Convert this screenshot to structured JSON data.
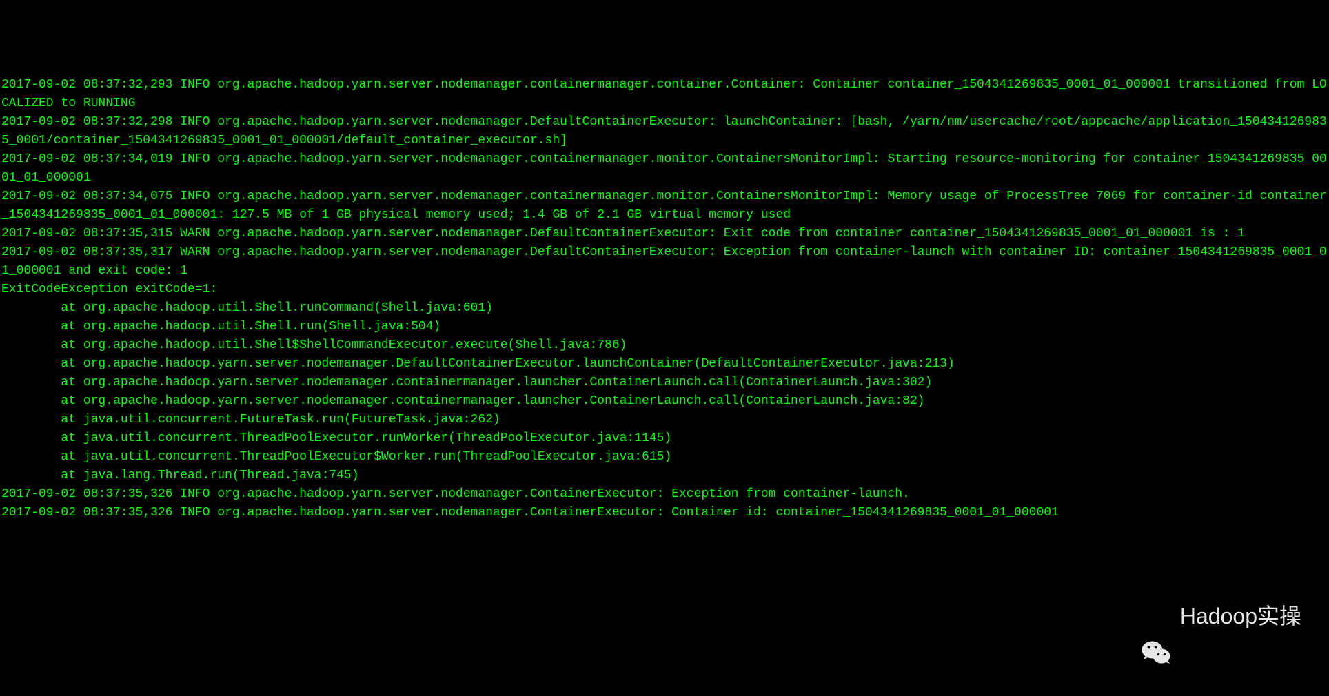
{
  "log": {
    "lines": [
      "2017-09-02 08:37:32,293 INFO org.apache.hadoop.yarn.server.nodemanager.containermanager.container.Container: Container container_1504341269835_0001_01_000001 transitioned from LOCALIZED to RUNNING",
      "2017-09-02 08:37:32,298 INFO org.apache.hadoop.yarn.server.nodemanager.DefaultContainerExecutor: launchContainer: [bash, /yarn/nm/usercache/root/appcache/application_1504341269835_0001/container_1504341269835_0001_01_000001/default_container_executor.sh]",
      "2017-09-02 08:37:34,019 INFO org.apache.hadoop.yarn.server.nodemanager.containermanager.monitor.ContainersMonitorImpl: Starting resource-monitoring for container_1504341269835_0001_01_000001",
      "2017-09-02 08:37:34,075 INFO org.apache.hadoop.yarn.server.nodemanager.containermanager.monitor.ContainersMonitorImpl: Memory usage of ProcessTree 7069 for container-id container_1504341269835_0001_01_000001: 127.5 MB of 1 GB physical memory used; 1.4 GB of 2.1 GB virtual memory used",
      "2017-09-02 08:37:35,315 WARN org.apache.hadoop.yarn.server.nodemanager.DefaultContainerExecutor: Exit code from container container_1504341269835_0001_01_000001 is : 1",
      "2017-09-02 08:37:35,317 WARN org.apache.hadoop.yarn.server.nodemanager.DefaultContainerExecutor: Exception from container-launch with container ID: container_1504341269835_0001_01_000001 and exit code: 1",
      "ExitCodeException exitCode=1:",
      "        at org.apache.hadoop.util.Shell.runCommand(Shell.java:601)",
      "        at org.apache.hadoop.util.Shell.run(Shell.java:504)",
      "        at org.apache.hadoop.util.Shell$ShellCommandExecutor.execute(Shell.java:786)",
      "        at org.apache.hadoop.yarn.server.nodemanager.DefaultContainerExecutor.launchContainer(DefaultContainerExecutor.java:213)",
      "        at org.apache.hadoop.yarn.server.nodemanager.containermanager.launcher.ContainerLaunch.call(ContainerLaunch.java:302)",
      "        at org.apache.hadoop.yarn.server.nodemanager.containermanager.launcher.ContainerLaunch.call(ContainerLaunch.java:82)",
      "        at java.util.concurrent.FutureTask.run(FutureTask.java:262)",
      "        at java.util.concurrent.ThreadPoolExecutor.runWorker(ThreadPoolExecutor.java:1145)",
      "        at java.util.concurrent.ThreadPoolExecutor$Worker.run(ThreadPoolExecutor.java:615)",
      "        at java.lang.Thread.run(Thread.java:745)",
      "2017-09-02 08:37:35,326 INFO org.apache.hadoop.yarn.server.nodemanager.ContainerExecutor: Exception from container-launch.",
      "2017-09-02 08:37:35,326 INFO org.apache.hadoop.yarn.server.nodemanager.ContainerExecutor: Container id: container_1504341269835_0001_01_000001"
    ]
  },
  "watermark": {
    "text": "Hadoop实操",
    "icon": "wechat-icon"
  }
}
